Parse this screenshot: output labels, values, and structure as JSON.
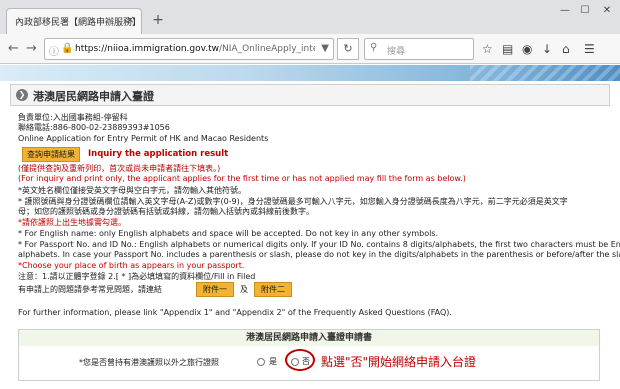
{
  "browser": {
    "tab_title": "內政部移民署【網路申辦服務】",
    "tab_close": "×",
    "new_tab": "+",
    "win_min": "—",
    "win_max": "☐",
    "win_close": "✕",
    "url_host": "https://niioa.immigration.gov.tw",
    "url_path": "/NIA_OnlineApply_inter/visafreeAp",
    "search_placeholder": "搜尋"
  },
  "page": {
    "title": "港澳居民網路申請入臺證",
    "contact_unit": "負責單位:入出國事務組-停留科",
    "contact_phone": "聯絡電話:886-800-02-23889393#1056",
    "online_app": "Online Application for Entry Permit of HK and Macao Residents",
    "inquiry_btn": "查詢申請結果",
    "inquiry_label": "Inquiry the application result",
    "note_cn": "(僅提供查詢及重新列印，首次或尚未申請者請往下填表。)",
    "note_en": "(For inquiry and print only, the applicant applies for the first time or has not applied may fill the form as below.)",
    "rule1": "*英文姓名欄位僅接受英文字母與空白字元，請勿輸入其他符號。",
    "rule2": "* 護照號碼與身分證號碼欄位請輸入英文字母(A-Z)或數字(0-9)，身分證號碼最多可輸入八字元，如您輸入身分證號碼長度為八字元，前二字元必須是英文字",
    "rule3": "母；如您的護照號碼或身分證號碼有括號或斜線，請勿輸入括號內或斜線前後數字。",
    "rule4": "*請依護照上出生地據實勾選。",
    "en1": "* For English name: only English alphabets and space will be  accepted. Do not  key in any other symbols.",
    "en2": "* For Passport No. and ID No.: English alphabets or numerical digits only. If your ID No. contains 8 digits/alphabets, the first two characters must be English",
    "en3": "alphabets. In case your Passport No. includes a parenthesis or slash, please do not key in the digits/alphabets in the parenthesis or before/after the slash.",
    "en4": "*Choose your place of birth as appears in your passport.",
    "note_fill": "注意：1.請以正體字登錄 2.[ * ]為必填填寫的資料欄位/Fill in Filed",
    "faq_cn": "有申請上的問題請參考常見問題，請連結",
    "appendix1": "附件一",
    "and": "及",
    "appendix2": "附件二",
    "faq_en": "For further information, please link \"Appendix 1\" and \"Appendix 2\" of the Frequently Asked Questions (FAQ).",
    "form_title": "港澳居民網路申請入臺證申請書",
    "form_question": "*您是否曾持有港澳護照以外之旅行證照",
    "opt_yes": "是",
    "opt_no": "否",
    "annotation": "點選\"否\"開始網絡申請入台證"
  }
}
